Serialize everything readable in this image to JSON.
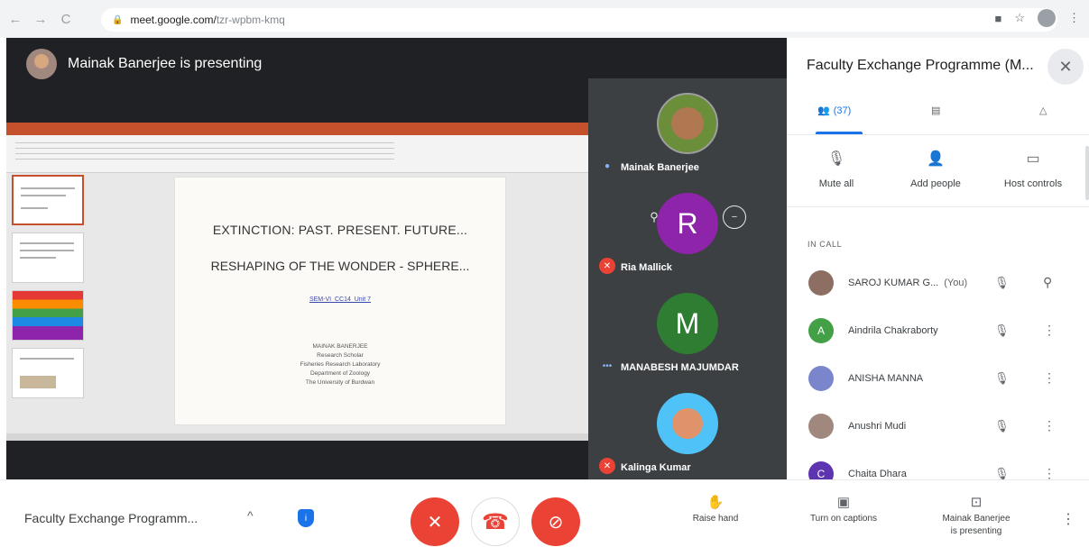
{
  "browser": {
    "back_icon": "←",
    "forward_icon": "→",
    "reload_icon": "C",
    "host": "meet.google.com/",
    "path": "tzr-wpbm-kmq"
  },
  "stage": {
    "presenter_text": "Mainak Banerjee is presenting"
  },
  "slide": {
    "line1": "EXTINCTION: PAST. PRESENT. FUTURE...",
    "line2": "RESHAPING OF THE WONDER - SPHERE...",
    "link": "SEM-VI_CC14_Unit 7",
    "author": [
      "MAINAK BANERJEE",
      "Research Scholar",
      "Fisheries Research Laboratory",
      "Department of Zoology",
      "The University of Burdwan"
    ]
  },
  "tiles": [
    {
      "name": "Mainak Banerjee",
      "initial": "",
      "color": "#6a8e3a"
    },
    {
      "name": "Ria Mallick",
      "initial": "R",
      "color": "#8e24aa"
    },
    {
      "name": "MANABESH MAJUMDAR",
      "initial": "M",
      "color": "#2e7d32"
    },
    {
      "name": "Kalinga Kumar",
      "initial": "",
      "color": "#4fc3f7"
    }
  ],
  "panel": {
    "title": "Faculty Exchange Programme (M...",
    "close": "✕",
    "people_count": "(37)",
    "actions": [
      "Mute all",
      "Add people",
      "Host controls"
    ],
    "in_call": "IN CALL",
    "participants": [
      {
        "name": "SAROJ KUMAR G...",
        "suffix": "(You)",
        "initial": "",
        "color": "#8d6e63"
      },
      {
        "name": "Aindrila Chakraborty",
        "suffix": "",
        "initial": "A",
        "color": "#43a047"
      },
      {
        "name": "ANISHA MANNA",
        "suffix": "",
        "initial": "",
        "color": "#7986cb"
      },
      {
        "name": "Anushri Mudi",
        "suffix": "",
        "initial": "",
        "color": "#a1887f"
      },
      {
        "name": "Chaita Dhara",
        "suffix": "",
        "initial": "C",
        "color": "#5e35b1"
      }
    ]
  },
  "bottom": {
    "meeting_name": "Faculty Exchange Programm...",
    "raise_hand": "Raise hand",
    "captions": "Turn on captions",
    "presenting_line1": "Mainak Banerjee",
    "presenting_line2": "is presenting"
  },
  "colors": {
    "red": "#ea4335",
    "blue": "#1a73e8",
    "dark": "#202124"
  }
}
